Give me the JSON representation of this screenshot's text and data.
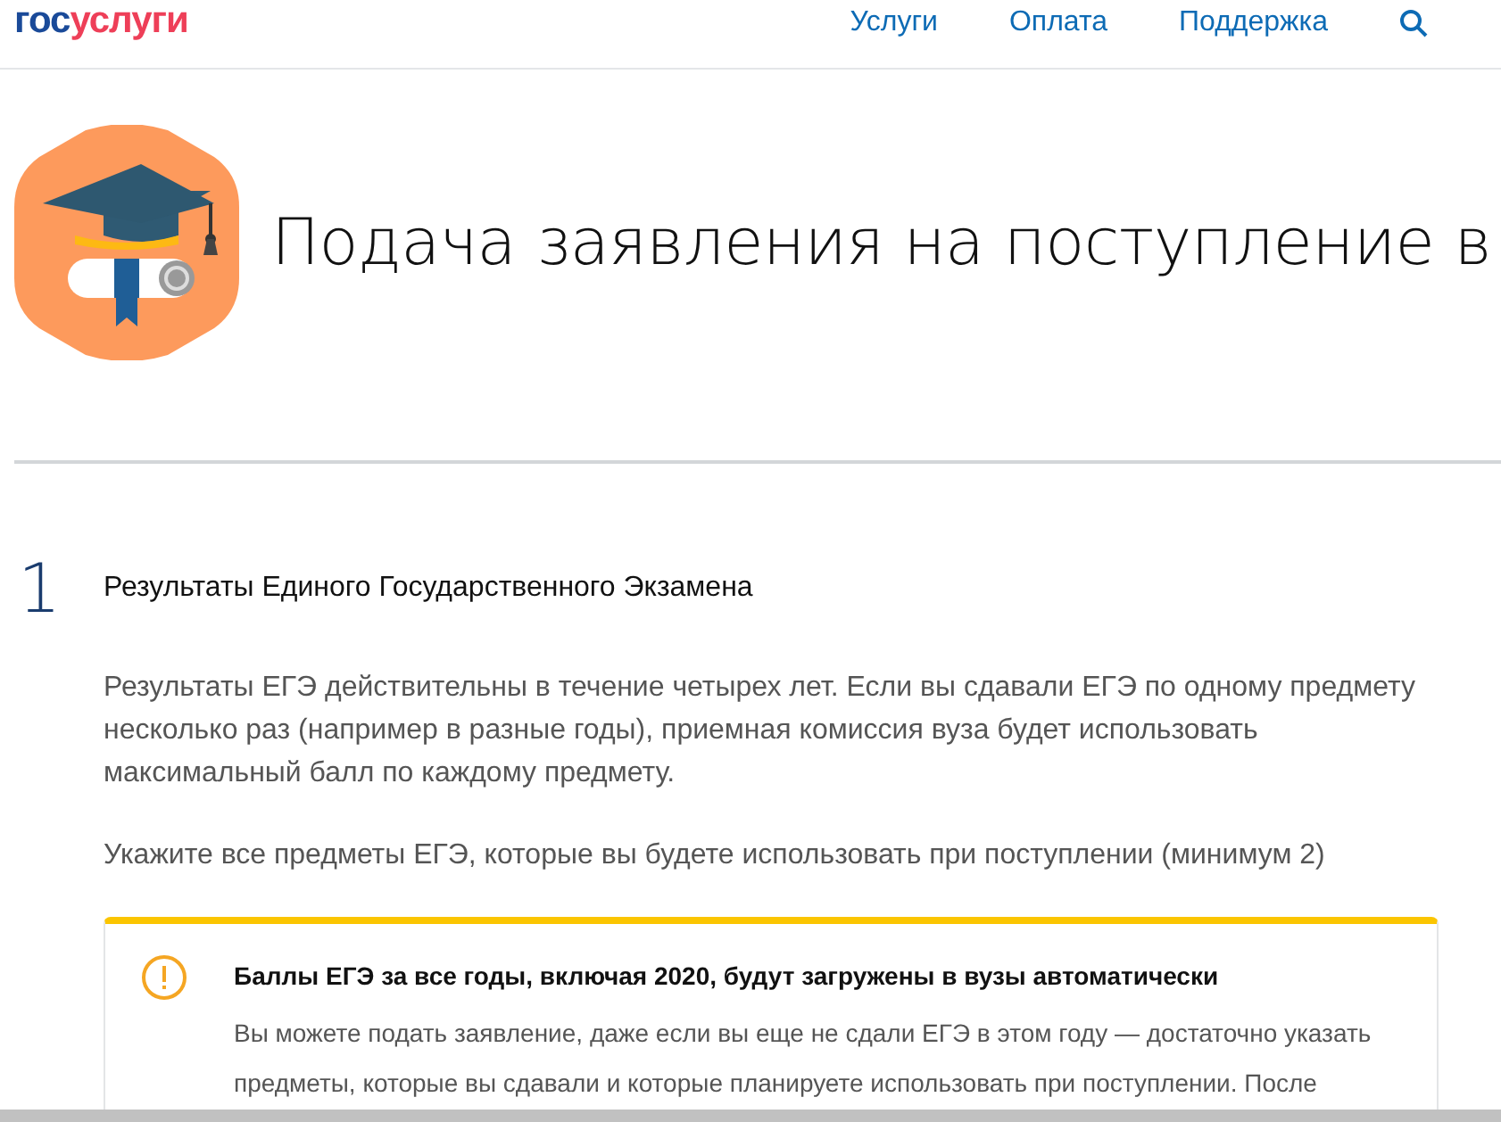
{
  "header": {
    "logo": {
      "part_1": "гос",
      "part_2": "услуги"
    },
    "nav": [
      {
        "label": "Услуги"
      },
      {
        "label": "Оплата"
      },
      {
        "label": "Поддержка"
      }
    ]
  },
  "hero": {
    "title": "Подача заявления на поступление в"
  },
  "step": {
    "number": "1",
    "title": "Результаты Единого Государственного Экзамена",
    "paragraphs": [
      "Результаты ЕГЭ действительны в течение четырех лет. Если вы сдавали ЕГЭ по одному предмету несколько раз (например в разные годы), приемная комиссия вуза будет использовать максимальный балл по каждому предмету.",
      "Укажите все предметы ЕГЭ, которые вы будете использовать при поступлении (минимум 2)"
    ],
    "notice": {
      "kind": "warning",
      "title": "Баллы ЕГЭ за все годы, включая 2020, будут загружены в вузы автоматически",
      "text": "Вы можете подать заявление, даже если вы еще не сдали ЕГЭ в этом году — достаточно указать предметы, которые вы сдавали и которые планируете использовать при поступлении. После"
    }
  }
}
